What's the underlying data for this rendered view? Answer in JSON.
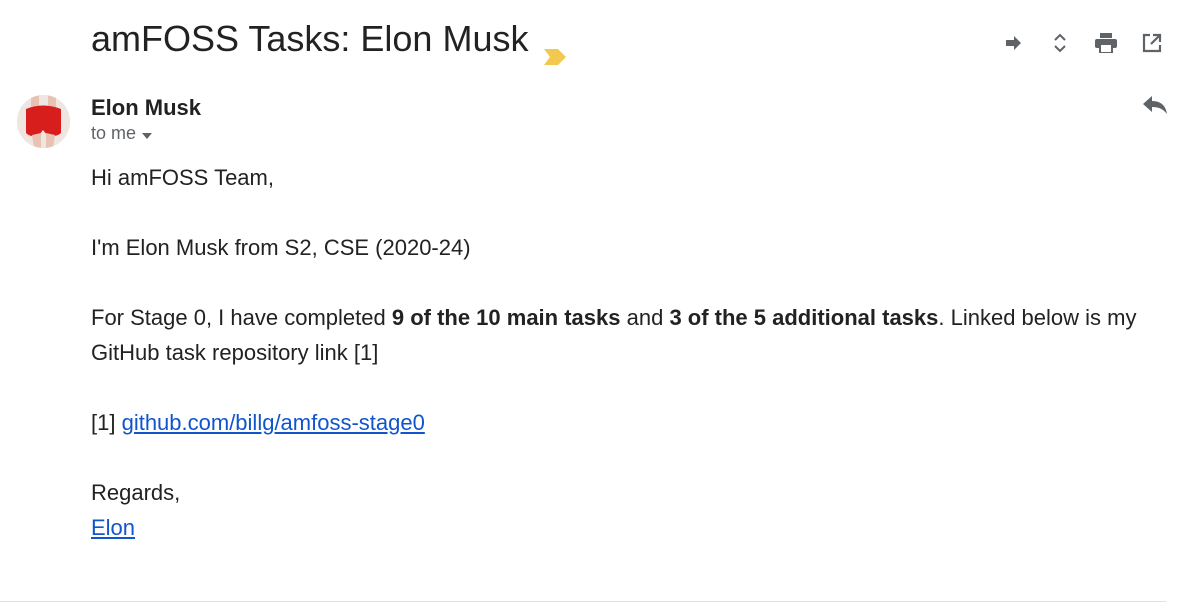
{
  "email": {
    "subject": "amFOSS Tasks: Elon Musk",
    "sender": "Elon Musk",
    "recipient": "to me",
    "greeting": "Hi amFOSS Team,",
    "intro": "I'm Elon Musk from S2, CSE (2020-24)",
    "stage_pre": "For Stage 0, I have completed ",
    "main_tasks": "9 of the 10 main tasks",
    "stage_mid": " and ",
    "additional_tasks": "3 of the 5 additional tasks",
    "stage_post": ". Linked below is my GitHub task repository link [1]",
    "ref_label": "[1] ",
    "ref_link": "github.com/billg/amfoss-stage0",
    "closing": "Regards,",
    "signature": "Elon"
  },
  "icons": {
    "importance": "importance-marker-icon",
    "forward": "forward-icon",
    "expand": "expand-all-icon",
    "print": "print-icon",
    "popout": "open-in-new-window-icon",
    "reply": "reply-icon",
    "dropdown": "chevron-down-icon"
  },
  "colors": {
    "importance": "#f2c94c",
    "link": "#1155cc",
    "icon": "#5f6368"
  }
}
